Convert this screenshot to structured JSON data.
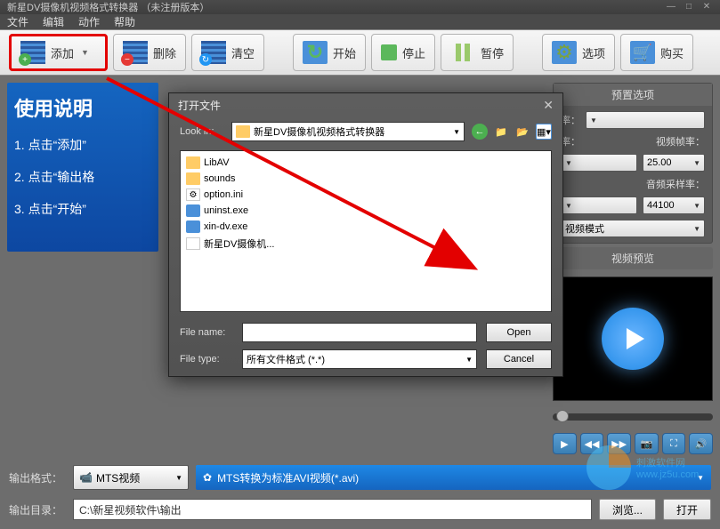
{
  "window": {
    "title": "新星DV摄像机视频格式转换器 （未注册版本）"
  },
  "menu": {
    "file": "文件",
    "edit": "编辑",
    "action": "动作",
    "help": "帮助"
  },
  "toolbar": {
    "add": "添加",
    "delete": "删除",
    "clear": "清空",
    "start": "开始",
    "stop": "停止",
    "pause": "暂停",
    "options": "选项",
    "buy": "购买"
  },
  "instructions": {
    "title": "使用说明",
    "step1": "1. 点击“添加”",
    "step2": "2. 点击“输出格",
    "step3": "3. 点击“开始”"
  },
  "settings": {
    "preset_title": "预置选项",
    "rate_label": "率：",
    "fps_label": "视频帧率：",
    "fps_value": "25.00",
    "audio_rate_label": "音频采样率：",
    "audio_rate_value": "44100",
    "video_mode": "视频模式",
    "preview_title": "视频预览"
  },
  "output": {
    "format_label": "输出格式：",
    "format_value": "MTS视频",
    "convert_value": "MTS转换为标准AVI视频(*.avi)",
    "dir_label": "输出目录：",
    "dir_value": "C:\\新星视频软件\\输出",
    "browse": "浏览...",
    "open": "打开"
  },
  "dialog": {
    "title": "打开文件",
    "lookin_label": "Look in:",
    "lookin_value": "新星DV摄像机视频格式转换器",
    "files": [
      {
        "name": "LibAV",
        "type": "folder"
      },
      {
        "name": "sounds",
        "type": "folder"
      },
      {
        "name": "option.ini",
        "type": "ini"
      },
      {
        "name": "uninst.exe",
        "type": "exe"
      },
      {
        "name": "xin-dv.exe",
        "type": "exe"
      },
      {
        "name": "新星DV摄像机...",
        "type": "file"
      }
    ],
    "filename_label": "File name:",
    "filename_value": "",
    "filetype_label": "File type:",
    "filetype_value": "所有文件格式 (*.*)",
    "open_btn": "Open",
    "cancel_btn": "Cancel"
  },
  "watermark": {
    "text1": "刺激软件网",
    "text2": "www.jz5u.com"
  }
}
